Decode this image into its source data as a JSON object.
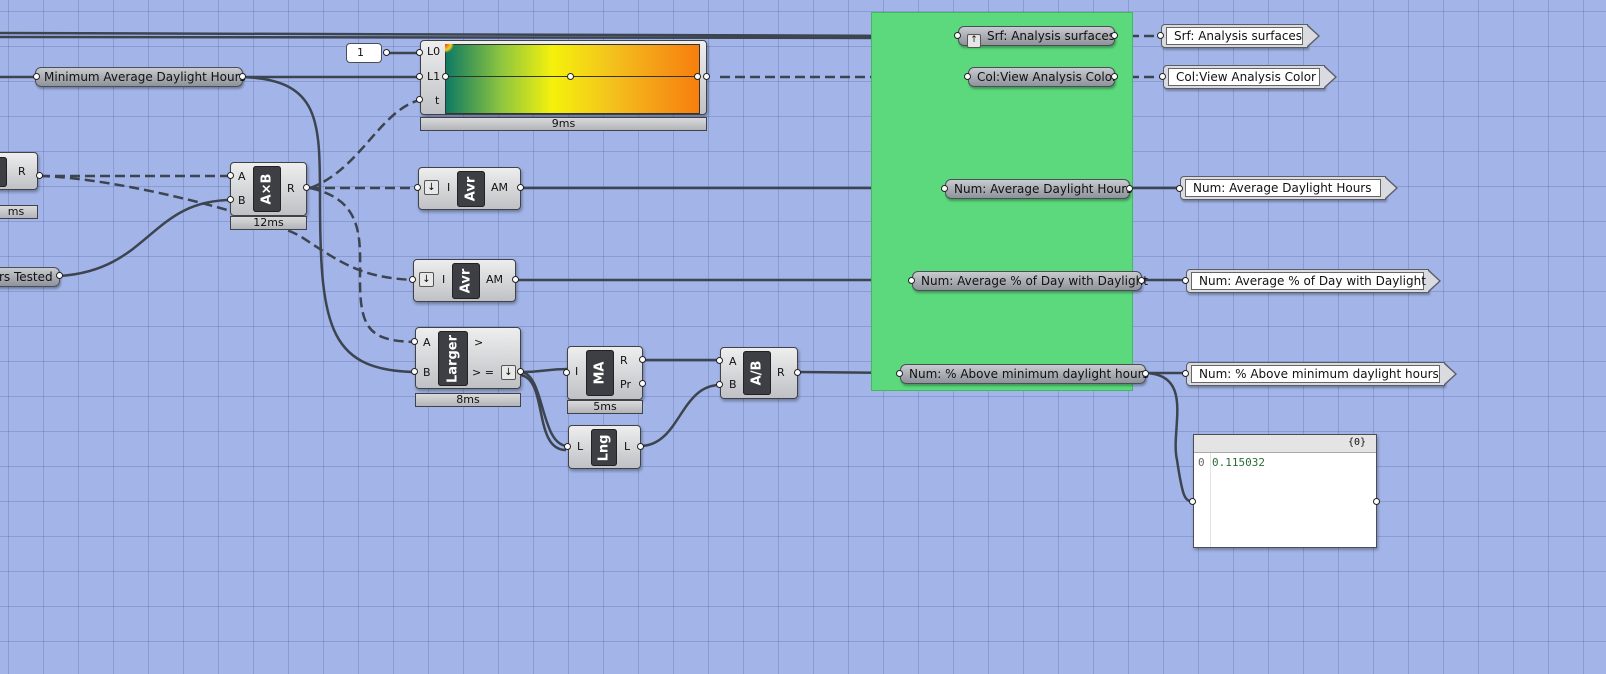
{
  "canvas": {
    "background": "#a3b5e8",
    "group_color": "#5bd97c"
  },
  "params": {
    "min_avg_hours": "Minimum Average Daylight Hours",
    "hours_tested_fragment": "rs Tested",
    "srf_analysis": "Srf: Analysis surfaces",
    "col_view": "Col:View Analysis Color",
    "num_avg_hours": "Num: Average Daylight Hours",
    "num_avg_pct": "Num: Average % of Day with Daylight",
    "num_pct_above": "Num: % Above minimum daylight hours"
  },
  "panels": {
    "srf_analysis": "Srf: Analysis surfaces",
    "col_view": "Col:View Analysis Color",
    "num_avg_hours": "Num: Average Daylight Hours",
    "num_avg_pct": "Num: Average % of Day with Daylight",
    "num_pct_above": "Num: % Above minimum daylight hours"
  },
  "slider": {
    "value": "1"
  },
  "gradient": {
    "inputs": [
      "L0",
      "L1",
      "t"
    ],
    "timer": "9ms"
  },
  "multiply": {
    "icon": "A×B",
    "inputs": [
      "A",
      "B"
    ],
    "output": "R",
    "timer": "12ms"
  },
  "partial_left": {
    "output": "R",
    "timer": "ms"
  },
  "average1": {
    "icon": "Avr",
    "input": "I",
    "output": "AM"
  },
  "average2": {
    "icon": "Avr",
    "input": "I",
    "output": "AM"
  },
  "larger": {
    "icon": "Larger",
    "inputs": [
      "A",
      "B"
    ],
    "outputs": [
      ">",
      "> ="
    ],
    "timer": "8ms"
  },
  "mass_add": {
    "icon": "MA",
    "input": "I",
    "outputs": [
      "R",
      "Pr"
    ],
    "timer": "5ms"
  },
  "length": {
    "icon": "Lng",
    "input": "L",
    "output": "L"
  },
  "divide": {
    "icon": "A/B",
    "inputs": [
      "A",
      "B"
    ],
    "output": "R"
  },
  "data_panel": {
    "header": "{0}",
    "index": "0",
    "value": "0.115032"
  }
}
